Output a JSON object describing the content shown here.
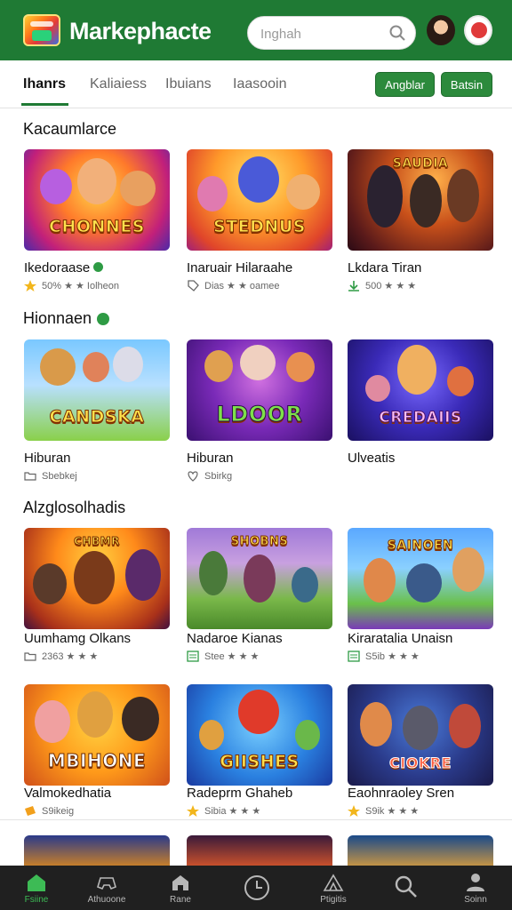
{
  "header": {
    "app_title": "Markephacte",
    "search_placeholder": "Inghah"
  },
  "tabs": {
    "items": [
      "Ihanrs",
      "Kaliaiess",
      "Ibuians",
      "Iaasooin"
    ],
    "button_primary": "Angblar",
    "button_secondary": "Batsin"
  },
  "sections": [
    {
      "title": "Kacaumlarce",
      "cards": [
        {
          "wordmark": "CHONNES",
          "name": "Ikedoraase",
          "meta": "50% ★ ★ Iolheon"
        },
        {
          "wordmark": "STEDNUS",
          "name": "Inaruair Hilaraahe",
          "meta": "Dias ★ ★ oamee"
        },
        {
          "wordmark": "SAUDIA",
          "name": "Lkdara Tiran",
          "meta": "500 ★ ★ ★"
        }
      ]
    },
    {
      "title": "Hionnaen",
      "cards": [
        {
          "wordmark": "CANDSKA",
          "name": "Hiburan",
          "meta": "Sbebkej"
        },
        {
          "wordmark": "LDOOR",
          "name": "Hiburan",
          "meta": "Sbirkg"
        },
        {
          "wordmark": "CREDAIIS",
          "name": "Ulveatis",
          "meta": ""
        }
      ]
    },
    {
      "title": "Alzglosolhadis",
      "cards": [
        {
          "wordmark": "CHBMR",
          "name": "Uumhamg Olkans",
          "meta": "2363 ★ ★ ★"
        },
        {
          "wordmark": "SHOBNS",
          "name": "Nadaroe Kianas",
          "meta": "Stee ★ ★ ★"
        },
        {
          "wordmark": "SAINOEN",
          "name": "Kiraratalia Unaisn",
          "meta": "S5ib ★ ★ ★"
        }
      ]
    },
    {
      "title": "",
      "cards": [
        {
          "wordmark": "MBIHONE",
          "name": "Valmokedhatia",
          "meta": "S9ikeig"
        },
        {
          "wordmark": "GIISHES",
          "name": "Radeprm Ghaheb",
          "meta": "Sibia ★ ★ ★"
        },
        {
          "wordmark": "CIOKRE",
          "name": "Eaohnraoley Sren",
          "meta": "S9ik ★ ★ ★"
        }
      ]
    }
  ],
  "bottom_nav": [
    {
      "label": "Fsiine",
      "icon": "home-icon"
    },
    {
      "label": "Athuoone",
      "icon": "controller-icon"
    },
    {
      "label": "Rane",
      "icon": "store-icon"
    },
    {
      "label": "",
      "icon": "clock-icon"
    },
    {
      "label": "Ptigitis",
      "icon": "tent-icon"
    },
    {
      "label": "",
      "icon": "search-icon"
    },
    {
      "label": "Soinn",
      "icon": "profile-icon"
    }
  ],
  "colors": {
    "brand_green": "#1f7a34",
    "nav_active": "#3dbb55",
    "bottom_nav_bg": "#202020"
  }
}
